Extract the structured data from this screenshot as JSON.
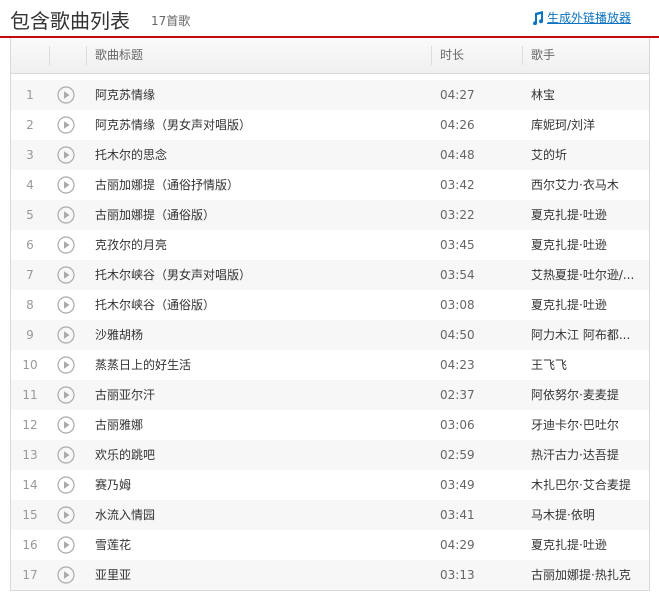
{
  "header": {
    "title": "包含歌曲列表",
    "count": "17首歌",
    "link_label": "生成外链播放器",
    "link_icon": "music-note-icon",
    "accent_color": "#c20c0c",
    "link_color": "#0c73c2"
  },
  "table": {
    "columns": {
      "title": "歌曲标题",
      "duration": "时长",
      "artist": "歌手"
    },
    "rows": [
      {
        "idx": "1",
        "title": "阿克苏情缘",
        "duration": "04:27",
        "artist": "林宝"
      },
      {
        "idx": "2",
        "title": "阿克苏情缘（男女声对唱版）",
        "duration": "04:26",
        "artist": "库妮珂/刘洋"
      },
      {
        "idx": "3",
        "title": "托木尔的思念",
        "duration": "04:48",
        "artist": "艾的圻"
      },
      {
        "idx": "4",
        "title": "古丽加娜提（通俗抒情版）",
        "duration": "03:42",
        "artist": "西尔艾力·衣马木"
      },
      {
        "idx": "5",
        "title": "古丽加娜提（通俗版）",
        "duration": "03:22",
        "artist": "夏克扎提·吐逊"
      },
      {
        "idx": "6",
        "title": "克孜尔的月亮",
        "duration": "03:45",
        "artist": "夏克扎提·吐逊"
      },
      {
        "idx": "7",
        "title": "托木尔峡谷（男女声对唱版）",
        "duration": "03:54",
        "artist": "艾热夏提·吐尔逊/..."
      },
      {
        "idx": "8",
        "title": "托木尔峡谷（通俗版）",
        "duration": "03:08",
        "artist": "夏克扎提·吐逊"
      },
      {
        "idx": "9",
        "title": "沙雅胡杨",
        "duration": "04:50",
        "artist": "阿力木江 阿布都..."
      },
      {
        "idx": "10",
        "title": "蒸蒸日上的好生活",
        "duration": "04:23",
        "artist": "王飞飞"
      },
      {
        "idx": "11",
        "title": "古丽亚尔汗",
        "duration": "02:37",
        "artist": "阿依努尔·麦麦提"
      },
      {
        "idx": "12",
        "title": "古丽雅娜",
        "duration": "03:06",
        "artist": "牙迪卡尔·巴吐尔"
      },
      {
        "idx": "13",
        "title": "欢乐的跳吧",
        "duration": "02:59",
        "artist": "热汗古力·达吾提"
      },
      {
        "idx": "14",
        "title": "赛乃姆",
        "duration": "03:49",
        "artist": "木扎巴尔·艾合麦提"
      },
      {
        "idx": "15",
        "title": "水流入情园",
        "duration": "03:41",
        "artist": "马木提·依明"
      },
      {
        "idx": "16",
        "title": "雪莲花",
        "duration": "04:29",
        "artist": "夏克扎提·吐逊"
      },
      {
        "idx": "17",
        "title": "亚里亚",
        "duration": "03:13",
        "artist": "古丽加娜提·热扎克"
      }
    ],
    "play_icon": "play-circle-icon"
  }
}
